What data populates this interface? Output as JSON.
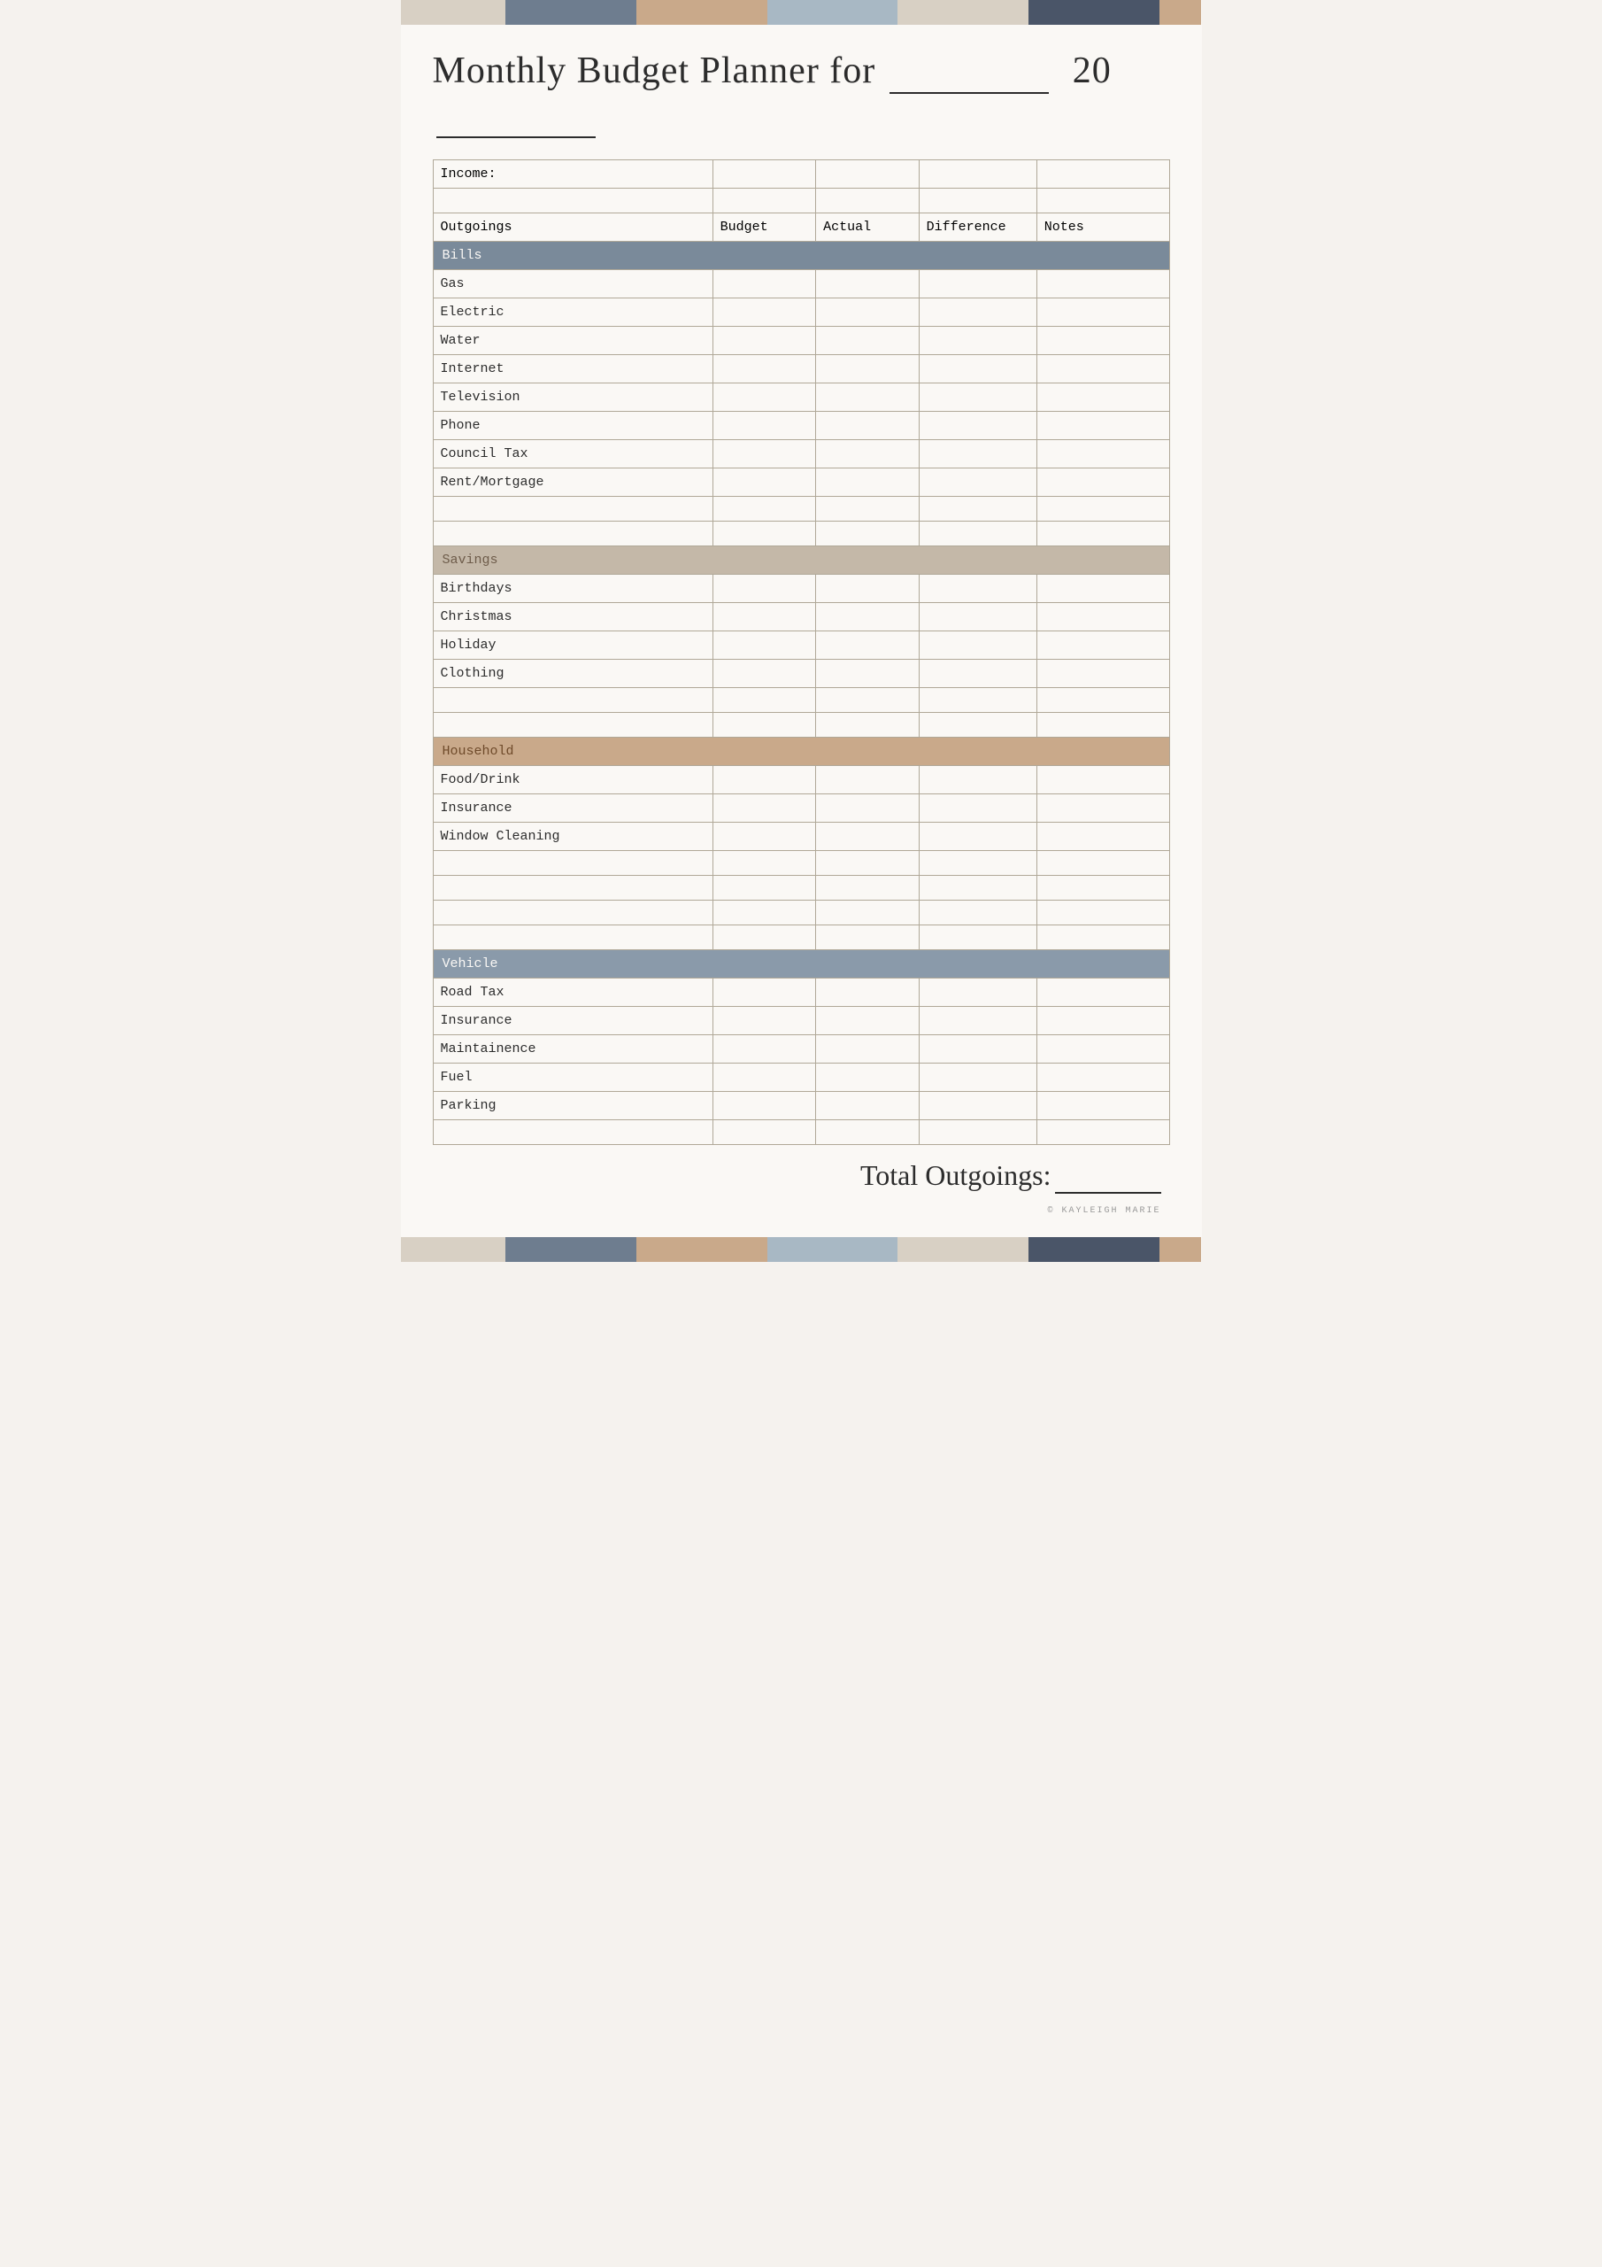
{
  "colorBar": {
    "colors": [
      "#d8d0c4",
      "#6e7d8f",
      "#c9a98a",
      "#a8b8c4",
      "#d8d0c4",
      "#4a5568",
      "#c9a98a"
    ]
  },
  "title": {
    "text": "Monthly Budget Planner for",
    "yearPrefix": "20"
  },
  "table": {
    "incomeLabel": "Income:",
    "columns": {
      "outgoings": "Outgoings",
      "budget": "Budget",
      "actual": "Actual",
      "difference": "Difference",
      "notes": "Notes"
    },
    "sections": {
      "bills": {
        "label": "Bills",
        "items": [
          "Gas",
          "Electric",
          "Water",
          "Internet",
          "Television",
          "Phone",
          "Council Tax",
          "Rent/Mortgage",
          "",
          ""
        ]
      },
      "savings": {
        "label": "Savings",
        "items": [
          "Birthdays",
          "Christmas",
          "Holiday",
          "Clothing",
          "",
          ""
        ]
      },
      "household": {
        "label": "Household",
        "items": [
          "Food/Drink",
          "Insurance",
          "Window Cleaning",
          "",
          "",
          "",
          ""
        ]
      },
      "vehicle": {
        "label": "Vehicle",
        "items": [
          "Road Tax",
          "Insurance",
          "Maintainence",
          "Fuel",
          "Parking",
          ""
        ]
      }
    }
  },
  "footer": {
    "totalLabel": "Total Outgoings:",
    "copyright": "© Kayleigh Marie"
  }
}
